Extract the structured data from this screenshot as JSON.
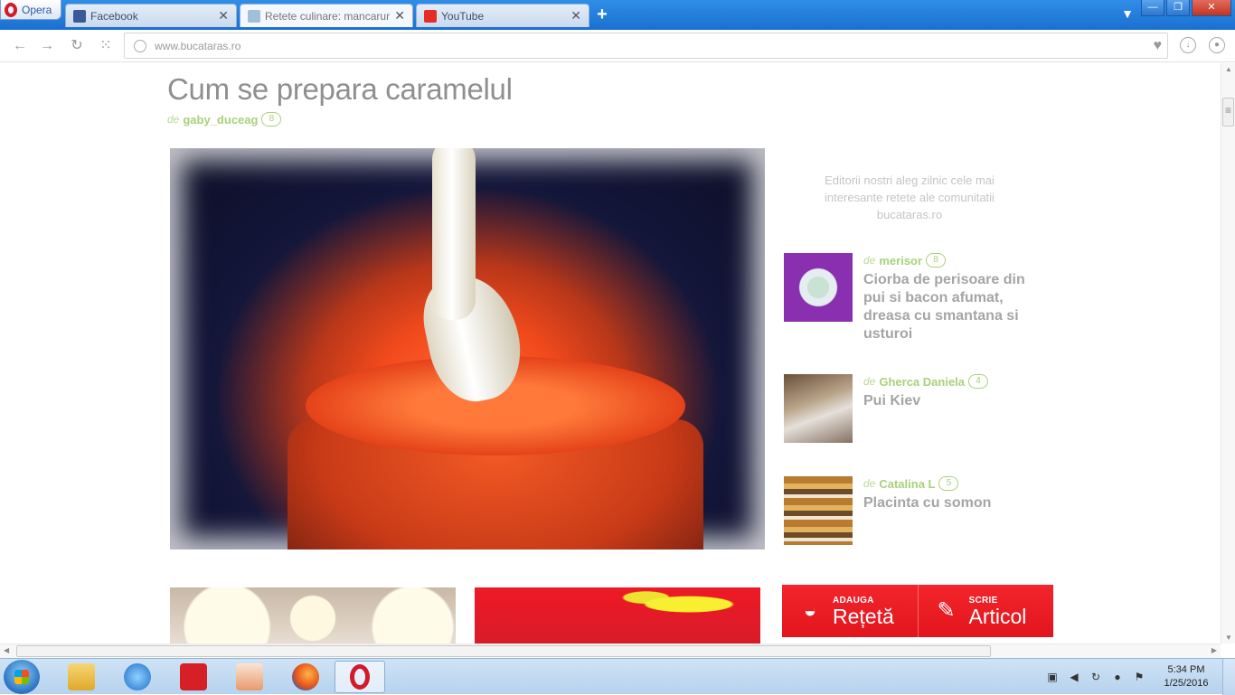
{
  "browser": {
    "menu_label": "Opera",
    "tabs": [
      {
        "title": "Facebook",
        "close": "✕"
      },
      {
        "title": "Retete culinare: mancaruri",
        "close": "✕"
      },
      {
        "title": "YouTube",
        "close": "✕"
      }
    ],
    "new_tab": "+",
    "url": "www.bucataras.ro"
  },
  "article": {
    "title": "Cum se prepara caramelul",
    "by_prefix": "de",
    "author": "gaby_duceag",
    "author_badge": "8"
  },
  "sidebar": {
    "editors_note": "Editorii nostri aleg zilnic cele mai interesante retete ale comunitatii bucataras.ro",
    "items": [
      {
        "by_prefix": "de",
        "author": "merisor",
        "badge": "8",
        "title": "Ciorba de perisoare din pui si bacon afumat, dreasa cu smantana si usturoi"
      },
      {
        "by_prefix": "de",
        "author": "Gherca Daniela",
        "badge": "4",
        "title": "Pui Kiev"
      },
      {
        "by_prefix": "de",
        "author": "Catalina L",
        "badge": "5",
        "title": "Placinta cu somon"
      }
    ]
  },
  "cta": {
    "add_small": "ADAUGA",
    "add_big": "Rețetă",
    "write_small": "SCRIE",
    "write_big": "Articol"
  },
  "taskbar": {
    "time": "5:34 PM",
    "date": "1/25/2016"
  },
  "colors": {
    "accent_green": "#a9d17b",
    "cta_red": "#e2151d",
    "title_gray": "#8f8f8f"
  }
}
